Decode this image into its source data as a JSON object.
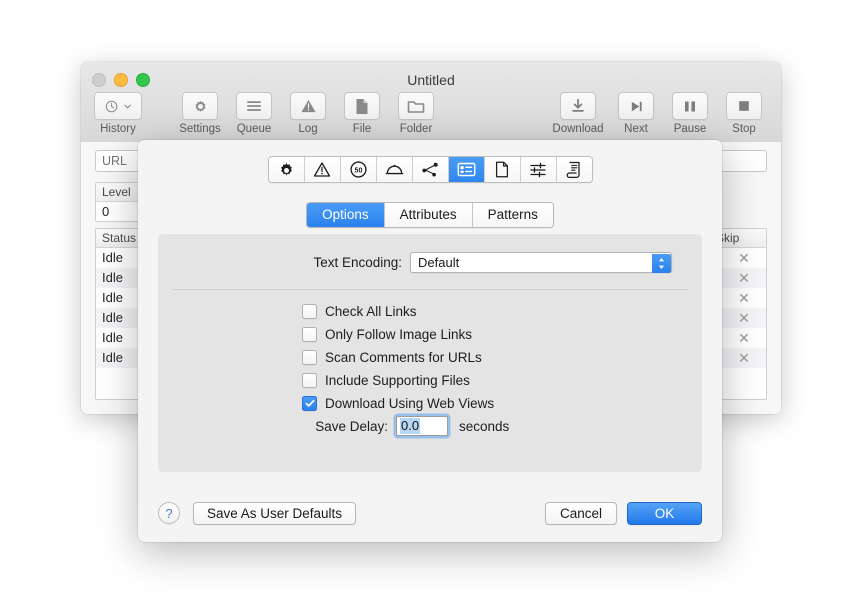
{
  "app_window": {
    "title": "Untitled",
    "traffic_lights": [
      "close-button",
      "minimize-button",
      "zoom-button"
    ],
    "toolbar": {
      "left_items": [
        {
          "label": "History",
          "icon": "clock-chevron-icon"
        }
      ],
      "mid_items": [
        {
          "label": "Settings",
          "icon": "gear-icon"
        },
        {
          "label": "Queue",
          "icon": "list-lines-icon"
        },
        {
          "label": "Log",
          "icon": "warning-triangle-icon"
        },
        {
          "label": "File",
          "icon": "document-icon"
        },
        {
          "label": "Folder",
          "icon": "folder-icon"
        }
      ],
      "right_items": [
        {
          "label": "Download",
          "icon": "download-arrow-icon"
        },
        {
          "label": "Next",
          "icon": "skip-next-icon"
        },
        {
          "label": "Pause",
          "icon": "pause-icon"
        },
        {
          "label": "Stop",
          "icon": "stop-square-icon"
        }
      ]
    },
    "url_field": {
      "value": "",
      "placeholder": "URL"
    },
    "level_panel": {
      "header": "Level",
      "value": "0"
    },
    "table": {
      "headers": {
        "status": "Status",
        "middle": "",
        "skip": "Skip"
      },
      "rows": [
        {
          "status": "Idle",
          "middle": "",
          "skip": "✕"
        },
        {
          "status": "Idle",
          "middle": "",
          "skip": "✕"
        },
        {
          "status": "Idle",
          "middle": "",
          "skip": "✕"
        },
        {
          "status": "Idle",
          "middle": "",
          "skip": "✕"
        },
        {
          "status": "Idle",
          "middle": "",
          "skip": "✕"
        },
        {
          "status": "Idle",
          "middle": "",
          "skip": "✕"
        }
      ]
    }
  },
  "dialog": {
    "icon_tabs": [
      {
        "icon": "gear-icon",
        "selected": false
      },
      {
        "icon": "warning-triangle-icon",
        "selected": false
      },
      {
        "icon": "speed-limit-50-icon",
        "selected": false
      },
      {
        "icon": "dome-cloche-icon",
        "selected": false
      },
      {
        "icon": "share-nodes-icon",
        "selected": false
      },
      {
        "icon": "list-view-icon",
        "selected": true
      },
      {
        "icon": "page-document-icon",
        "selected": false
      },
      {
        "icon": "sliders-icon",
        "selected": false
      },
      {
        "icon": "scroll-script-icon",
        "selected": false
      }
    ],
    "tabs": [
      {
        "label": "Options",
        "selected": true
      },
      {
        "label": "Attributes",
        "selected": false
      },
      {
        "label": "Patterns",
        "selected": false
      }
    ],
    "encoding": {
      "label": "Text Encoding:",
      "value": "Default"
    },
    "checkboxes": [
      {
        "label": "Check All Links",
        "checked": false
      },
      {
        "label": "Only Follow Image Links",
        "checked": false
      },
      {
        "label": "Scan Comments for URLs",
        "checked": false
      },
      {
        "label": "Include Supporting Files",
        "checked": false
      },
      {
        "label": "Download Using Web Views",
        "checked": true
      }
    ],
    "save_delay": {
      "label": "Save Delay:",
      "value": "0.0",
      "unit": "seconds"
    },
    "footer": {
      "help_label": "?",
      "save_defaults_label": "Save As User Defaults",
      "cancel_label": "Cancel",
      "ok_label": "OK"
    }
  },
  "colors": {
    "accent": "#2b82ee",
    "dialog_bg": "#f4f4f4",
    "panel_bg": "#e4e4e4"
  }
}
